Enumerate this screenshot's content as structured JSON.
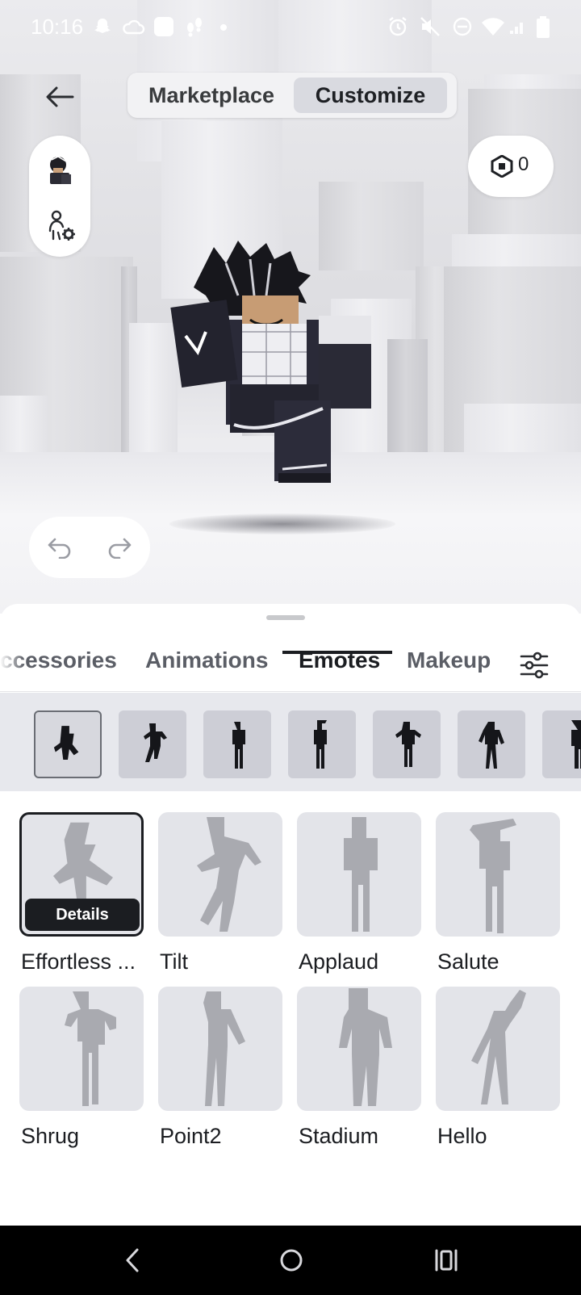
{
  "status_bar": {
    "time": "10:16"
  },
  "top_nav": {
    "tabs": [
      {
        "label": "Marketplace",
        "active": false
      },
      {
        "label": "Customize",
        "active": true
      }
    ]
  },
  "robux": {
    "count": "0"
  },
  "categories": {
    "tabs": [
      {
        "label": "ccessories",
        "active": false
      },
      {
        "label": "Animations",
        "active": false
      },
      {
        "label": "Emotes",
        "active": true
      },
      {
        "label": "Makeup",
        "active": false
      }
    ]
  },
  "emotes": [
    {
      "label": "Effortless ...",
      "selected": true,
      "details_label": "Details"
    },
    {
      "label": "Tilt"
    },
    {
      "label": "Applaud"
    },
    {
      "label": "Salute"
    },
    {
      "label": "Shrug"
    },
    {
      "label": "Point2"
    },
    {
      "label": "Stadium"
    },
    {
      "label": "Hello"
    }
  ],
  "colors": {
    "accent": "#1b1d21",
    "tile_bg": "#e3e4e9",
    "strip_bg": "#e7e8ed"
  }
}
